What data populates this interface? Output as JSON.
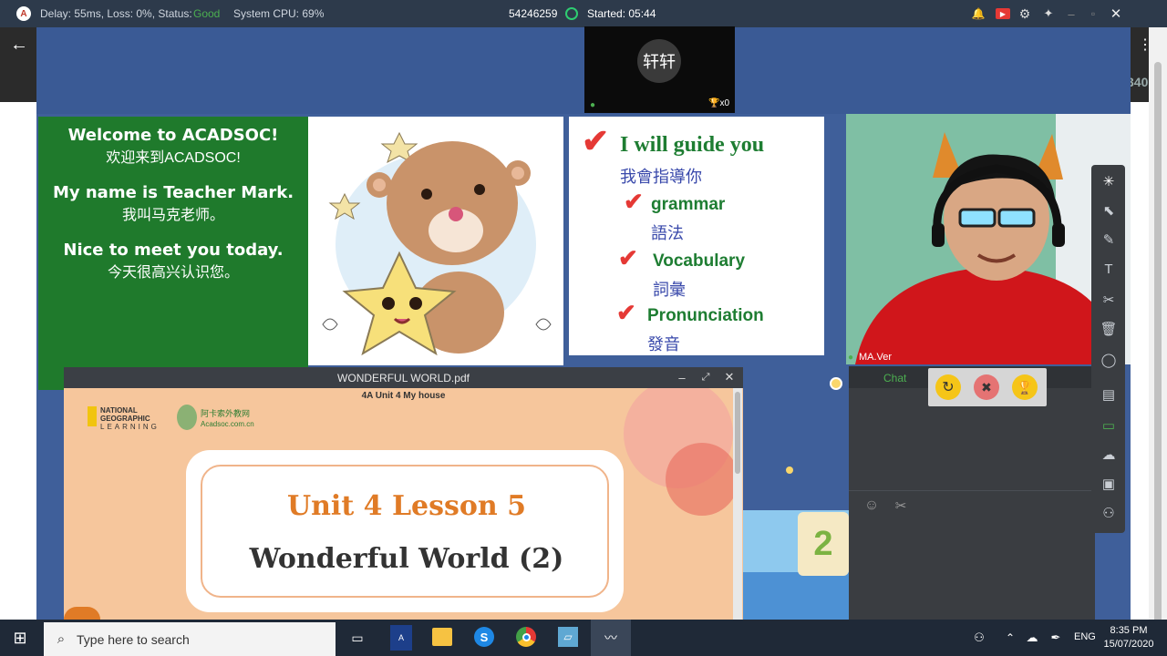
{
  "topbar": {
    "delay_label": "Delay: 55ms, Loss: 0%, Status:",
    "status": "Good",
    "cpu": "System CPU: 69%",
    "room_id": "54246259",
    "started": "Started: 05:44",
    "accent_good": "#4caf50"
  },
  "top_camera": {
    "name": "轩轩",
    "trophy_count": "x0"
  },
  "welcome_slide": {
    "line1_en": "Welcome to ACADSOC!",
    "line1_cn": "欢迎来到ACADSOC!",
    "line2_en": "My name is Teacher Mark.",
    "line2_cn": "我叫马克老师。",
    "line3_en": "Nice to meet you today.",
    "line3_cn": "今天很高兴认识您。"
  },
  "guide_slide": {
    "title": "I will guide you",
    "title_cn": "我會指導你",
    "items": [
      {
        "en": "grammar",
        "cn": "語法"
      },
      {
        "en": "Vocabulary",
        "cn": "詞彙"
      },
      {
        "en": "Pronunciation",
        "cn": "發音"
      }
    ]
  },
  "teacher_video": {
    "name": "MA.Ver"
  },
  "pdf": {
    "window_title": "WONDERFUL WORLD.pdf",
    "page_header": "4A Unit 4 My house",
    "brand1_line1": "NATIONAL",
    "brand1_line2": "GEOGRAPHIC",
    "brand1_line3": "LEARNING",
    "brand2_line1": "阿卡索外教网",
    "brand2_line2": "Acadsoc.com.cn",
    "lesson_title": "Unit 4 Lesson 5",
    "lesson_subtitle": "Wonderful World (2)"
  },
  "chat": {
    "tab_label": "Chat"
  },
  "side_text": "340",
  "taskbar": {
    "search_placeholder": "Type here to search",
    "lang": "ENG",
    "time": "8:35 PM",
    "date": "15/07/2020"
  }
}
